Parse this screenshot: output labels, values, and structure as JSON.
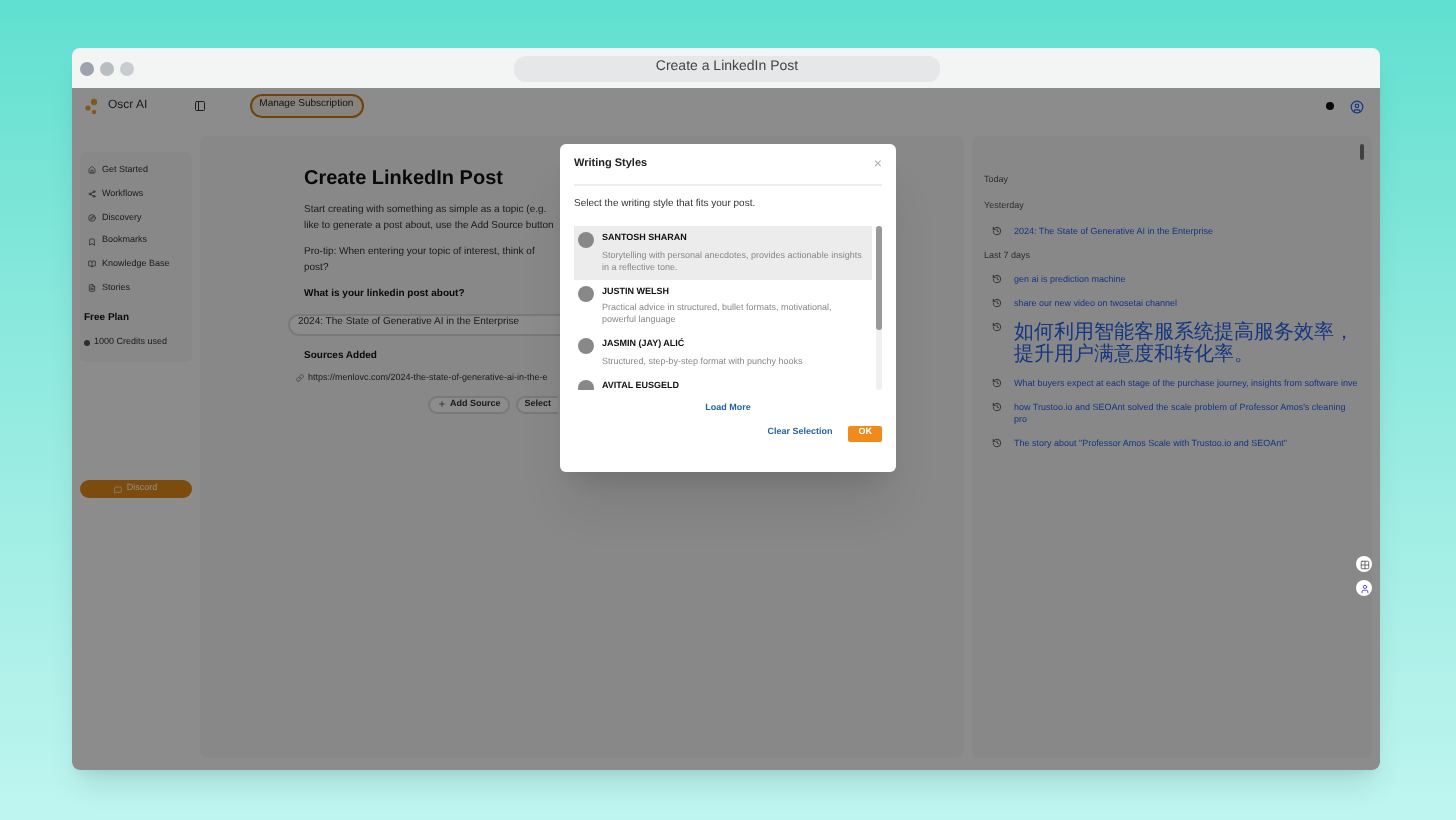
{
  "window": {
    "title": "Create a LinkedIn Post"
  },
  "header": {
    "brand": "Oscr AI",
    "manage_button": "Manage Subscription"
  },
  "sidebar": {
    "items": [
      {
        "label": "Get Started"
      },
      {
        "label": "Workflows"
      },
      {
        "label": "Discovery"
      },
      {
        "label": "Bookmarks"
      },
      {
        "label": "Knowledge Base"
      },
      {
        "label": "Stories"
      }
    ],
    "plan_title": "Free Plan",
    "credits": "1000 Credits used",
    "discord_button": "Discord"
  },
  "main": {
    "title": "Create LinkedIn Post",
    "intro": [
      "Start creating with something as simple as a topic (e.g.",
      "like to generate a post about, use the Add Source button"
    ],
    "protip": [
      "Pro-tip: When entering your topic of interest, think of",
      "post?"
    ],
    "question_label": "What is your linkedin post about?",
    "topic_value": "2024: The State of Generative AI in the Enterprise",
    "sources_label": "Sources Added",
    "sources": [
      "https://menlovc.com/2024-the-state-of-generative-ai-in-the-e"
    ],
    "add_source_button": "Add Source",
    "select_button": "Select"
  },
  "history": {
    "groups": [
      {
        "label": "Today"
      },
      {
        "label": "Yesterday",
        "items": [
          "2024: The State of Generative AI in the Enterprise"
        ]
      },
      {
        "label": "Last 7 days",
        "items": [
          "gen ai is prediction machine",
          "share our new video on twosetai channel",
          "如何利用智能客服系统提高服务效率，提升用户满意度和转化率。",
          "What buyers expect at each stage of the purchase journey, insights from software inve",
          "how Trustoo.io and SEOAnt solved the scale problem of Professor Amos's cleaning pro",
          "The story about \"Professor Amos Scale with Trustoo.io and SEOAnt\""
        ]
      }
    ]
  },
  "modal": {
    "title": "Writing Styles",
    "close": "×",
    "subtitle": "Select the writing style that fits your post.",
    "styles": [
      {
        "name": "SANTOSH SHARAN",
        "description": "Storytelling with personal anecdotes, provides actionable insights in a reflective tone.",
        "selected": true
      },
      {
        "name": "JUSTIN WELSH",
        "description": "Practical advice in structured, bullet formats, motivational, powerful language",
        "selected": false
      },
      {
        "name": "JASMIN (JAY) ALIĆ",
        "description": "Structured, step-by-step format with punchy hooks",
        "selected": false
      },
      {
        "name": "AVITAL EUSGELD",
        "selected": false
      }
    ],
    "load_more": "Load More",
    "clear_button": "Clear Selection",
    "ok_button": "OK"
  }
}
